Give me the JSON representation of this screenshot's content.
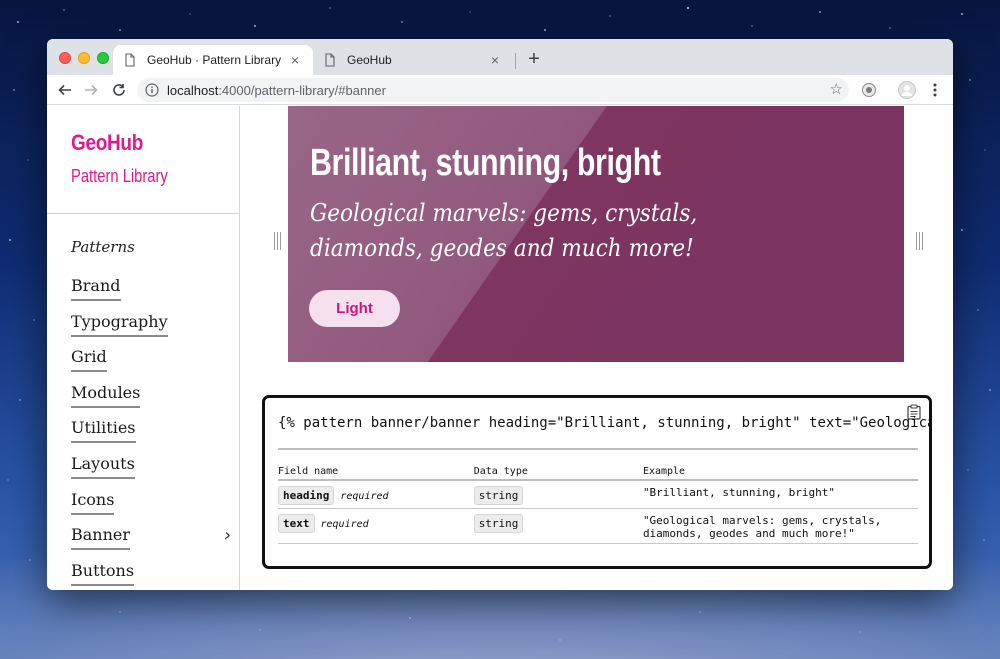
{
  "browser": {
    "tabs": [
      {
        "title": "GeoHub · Pattern Library",
        "active": true
      },
      {
        "title": "GeoHub",
        "active": false
      }
    ],
    "new_tab_label": "+",
    "url_host": "localhost",
    "url_path": ":4000/pattern-library/#banner",
    "bookmark_icon": "star-icon"
  },
  "sidebar": {
    "brand_title": "GeoHub",
    "brand_subtitle": "Pattern Library",
    "nav_heading": "Patterns",
    "items": [
      {
        "label": "Brand"
      },
      {
        "label": "Typography"
      },
      {
        "label": "Grid"
      },
      {
        "label": "Modules"
      },
      {
        "label": "Utilities"
      },
      {
        "label": "Layouts"
      },
      {
        "label": "Icons"
      },
      {
        "label": "Banner",
        "chevron": "›"
      },
      {
        "label": "Buttons"
      }
    ]
  },
  "banner": {
    "heading": "Brilliant, stunning, bright",
    "text": "Geological marvels: gems, crystals, diamonds, geodes and much more!",
    "button_label": "Light"
  },
  "code": {
    "snippet": "{% pattern banner/banner heading=\"Brilliant, stunning, bright\" text=\"Geological marvels: gems, crystals, diamonds, geodes and much more!\" %}",
    "columns": [
      "Field name",
      "Data type",
      "Example"
    ],
    "rows": [
      {
        "field": "heading",
        "required": "required",
        "type": "string",
        "example": "\"Brilliant, stunning, bright\""
      },
      {
        "field": "text",
        "required": "required",
        "type": "string",
        "example": "\"Geological marvels: gems, crystals, diamonds, geodes and much more!\""
      }
    ]
  },
  "colors": {
    "brand_accent": "#dd1a8e",
    "banner_bg": "#7e3560",
    "banner_button_bg": "#f5e1ee"
  }
}
